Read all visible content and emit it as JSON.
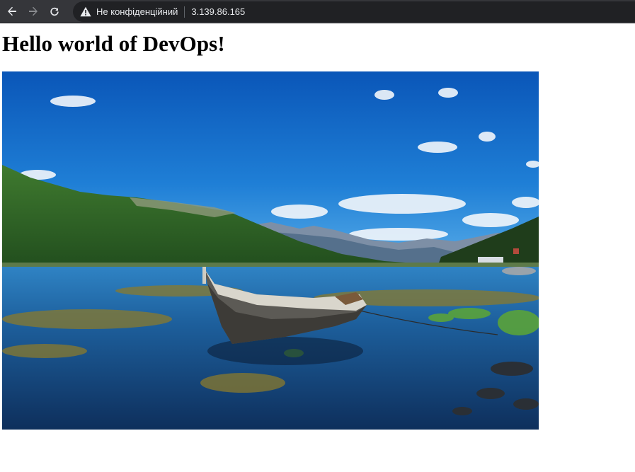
{
  "browser": {
    "back_icon": "arrow-left-icon",
    "forward_icon": "arrow-right-icon",
    "reload_icon": "reload-icon",
    "security_icon": "warning-triangle-icon",
    "security_label": "Не конфіденційний",
    "url": "3.139.86.165",
    "colors": {
      "toolbar": "#35363a",
      "omnibox": "#202124",
      "text": "#e8eaed"
    }
  },
  "page": {
    "heading": "Hello world of DevOps!",
    "image": {
      "subject": "wooden rowboat on a clear fjord shore with mountains under blue sky"
    }
  }
}
